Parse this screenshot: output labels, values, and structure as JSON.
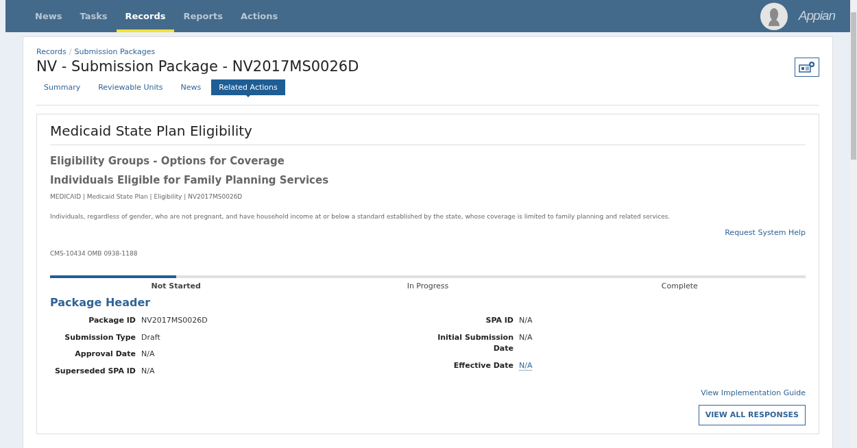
{
  "top_nav": {
    "items": [
      {
        "label": "News",
        "selected": false
      },
      {
        "label": "Tasks",
        "selected": false
      },
      {
        "label": "Records",
        "selected": true
      },
      {
        "label": "Reports",
        "selected": false
      },
      {
        "label": "Actions",
        "selected": false
      }
    ],
    "brand": "Appian"
  },
  "breadcrumbs": [
    "Records",
    "Submission Packages"
  ],
  "breadcrumb_separator": "/",
  "title": "NV - Submission Package - NV2017MS0026D",
  "tabs": [
    {
      "label": "Summary",
      "selected": false
    },
    {
      "label": "Reviewable Units",
      "selected": false
    },
    {
      "label": "News",
      "selected": false
    },
    {
      "label": "Related Actions",
      "selected": true
    }
  ],
  "form": {
    "heading": "Medicaid State Plan Eligibility",
    "subheading": "Eligibility Groups - Options for Coverage",
    "group_title": "Individuals Eligible for Family Planning Services",
    "path": "MEDICAID | Medicaid State Plan | Eligibility | NV2017MS0026D",
    "description": "Individuals, regardless of gender, who are not pregnant, and have household income at or below a standard established by the state, whose coverage is limited to family planning and related services.",
    "help_link": "Request System Help",
    "omb": "CMS-10434 OMB 0938-1188",
    "steps": [
      {
        "label": "Not Started",
        "selected": true
      },
      {
        "label": "In Progress",
        "selected": false
      },
      {
        "label": "Complete",
        "selected": false
      }
    ],
    "section_title": "Package Header",
    "left_fields": [
      {
        "label": "Package ID",
        "value": "NV2017MS0026D"
      },
      {
        "label": "Submission Type",
        "value": "Draft"
      },
      {
        "label": "Approval Date",
        "value": "N/A"
      },
      {
        "label": "Superseded SPA ID",
        "value": "N/A"
      }
    ],
    "right_fields": [
      {
        "label": "SPA ID",
        "value": "N/A",
        "kind": "text"
      },
      {
        "label": "Initial Submission Date",
        "value": "N/A",
        "kind": "text"
      },
      {
        "label": "Effective Date",
        "value": "N/A",
        "kind": "link"
      }
    ],
    "guide_link": "View Implementation Guide",
    "responses_button": "VIEW ALL RESPONSES"
  }
}
